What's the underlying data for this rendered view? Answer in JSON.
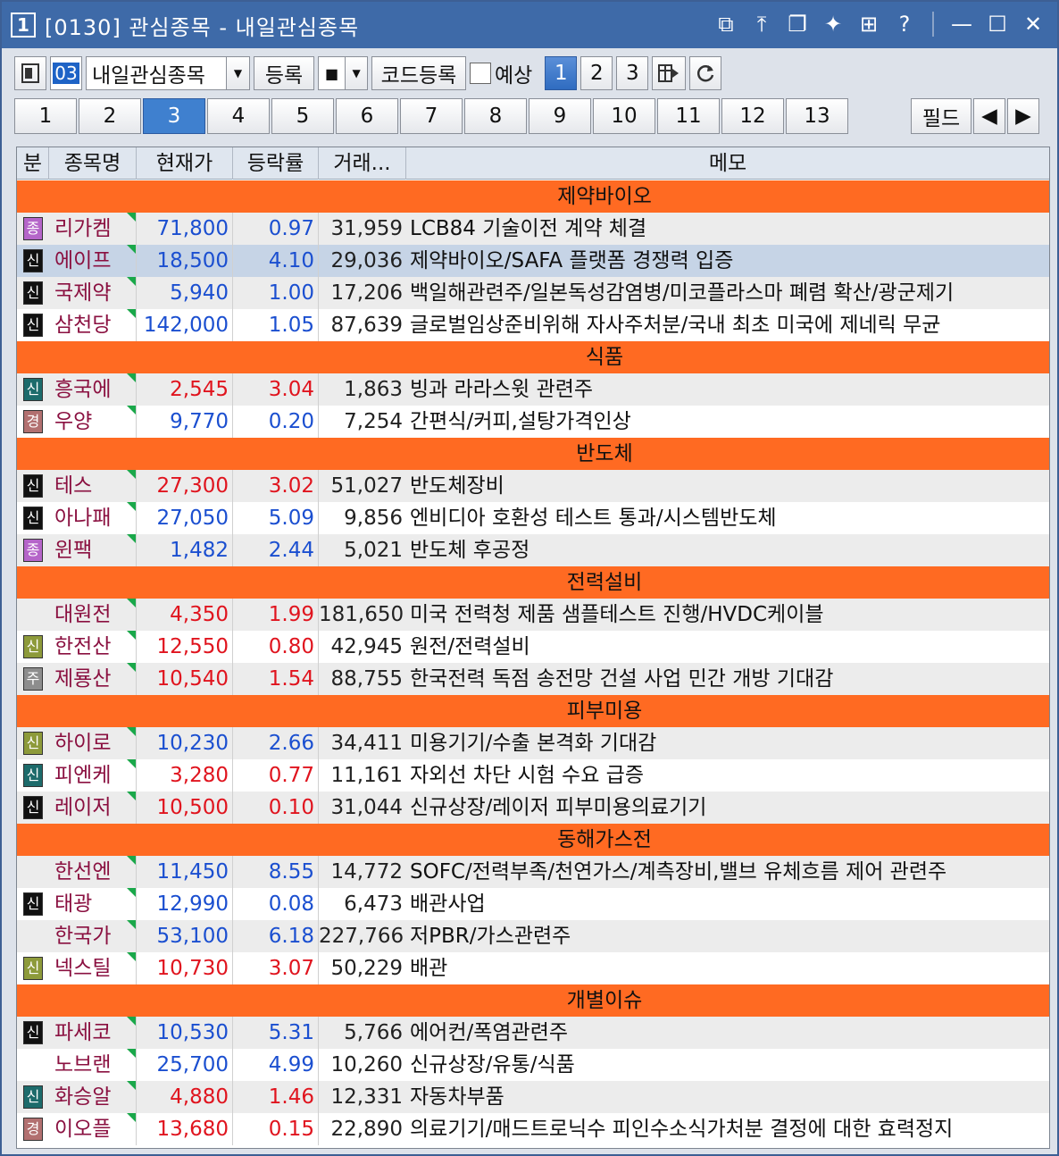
{
  "window": {
    "number": "1",
    "title": "[0130] 관심종목 - 내일관심종목"
  },
  "toolbar": {
    "group_code": "03",
    "group_name": "내일관심종목",
    "register_label": "등록",
    "code_register_label": "코드등록",
    "forecast_label": "예상",
    "pages": [
      "1",
      "2",
      "3"
    ],
    "active_page": "1"
  },
  "tabs": [
    "1",
    "2",
    "3",
    "4",
    "5",
    "6",
    "7",
    "8",
    "9",
    "10",
    "11",
    "12",
    "13"
  ],
  "active_tab": "3",
  "field_label": "필드",
  "columns": {
    "bun": "분",
    "name": "종목명",
    "price": "현재가",
    "rate": "등락률",
    "volume": "거래...",
    "memo": "메모"
  },
  "groups": [
    {
      "title": "제약바이오",
      "rows": [
        {
          "badge": "종",
          "name": "리가켐",
          "price": "71,800",
          "rate": "0.97",
          "volume": "31,959",
          "memo": "LCB84 기술이전 계약 체결",
          "dir": "dn"
        },
        {
          "badge": "신",
          "name": "에이프",
          "price": "18,500",
          "rate": "4.10",
          "volume": "29,036",
          "memo": "제약바이오/SAFA 플랫폼 경쟁력 입증",
          "dir": "dn",
          "selected": true
        },
        {
          "badge": "신",
          "name": "국제약",
          "price": "5,940",
          "rate": "1.00",
          "volume": "17,206",
          "memo": "백일해관련주/일본독성감염병/미코플라스마 폐렴 확산/광군제기",
          "dir": "dn"
        },
        {
          "badge": "신",
          "name": "삼천당",
          "price": "142,000",
          "rate": "1.05",
          "volume": "87,639",
          "memo": "글로벌임상준비위해 자사주처분/국내 최초 미국에 제네릭 무균",
          "dir": "dn"
        }
      ]
    },
    {
      "title": "식품",
      "rows": [
        {
          "badge": "신",
          "name": "흥국에",
          "price": "2,545",
          "rate": "3.04",
          "volume": "1,863",
          "memo": "빙과 라라스윗 관련주",
          "dir": "up"
        },
        {
          "badge": "경",
          "name": "우양",
          "price": "9,770",
          "rate": "0.20",
          "volume": "7,254",
          "memo": "간편식/커피,설탕가격인상",
          "dir": "dn"
        }
      ]
    },
    {
      "title": "반도체",
      "rows": [
        {
          "badge": "신",
          "name": "테스",
          "price": "27,300",
          "rate": "3.02",
          "volume": "51,027",
          "memo": "반도체장비",
          "dir": "up"
        },
        {
          "badge": "신",
          "name": "아나패",
          "price": "27,050",
          "rate": "5.09",
          "volume": "9,856",
          "memo": "엔비디아 호환성 테스트 통과/시스템반도체",
          "dir": "dn"
        },
        {
          "badge": "종",
          "name": "윈팩",
          "price": "1,482",
          "rate": "2.44",
          "volume": "5,021",
          "memo": "반도체 후공정",
          "dir": "dn"
        }
      ]
    },
    {
      "title": "전력설비",
      "rows": [
        {
          "badge": "",
          "name": "대원전",
          "price": "4,350",
          "rate": "1.99",
          "volume": "181,650",
          "memo": "미국 전력청 제품 샘플테스트 진행/HVDC케이블",
          "dir": "up"
        },
        {
          "badge": "신",
          "name": "한전산",
          "price": "12,550",
          "rate": "0.80",
          "volume": "42,945",
          "memo": "원전/전력설비",
          "dir": "up"
        },
        {
          "badge": "주",
          "name": "제룡산",
          "price": "10,540",
          "rate": "1.54",
          "volume": "88,755",
          "memo": "한국전력 독점 송전망 건설 사업 민간 개방 기대감",
          "dir": "up"
        }
      ]
    },
    {
      "title": "피부미용",
      "rows": [
        {
          "badge": "신",
          "name": "하이로",
          "price": "10,230",
          "rate": "2.66",
          "volume": "34,411",
          "memo": "미용기기/수출 본격화 기대감",
          "dir": "dn"
        },
        {
          "badge": "신",
          "name": "피엔케",
          "price": "3,280",
          "rate": "0.77",
          "volume": "11,161",
          "memo": "자외선 차단 시험 수요 급증",
          "dir": "up"
        },
        {
          "badge": "신",
          "name": "레이저",
          "price": "10,500",
          "rate": "0.10",
          "volume": "31,044",
          "memo": "신규상장/레이저 피부미용의료기기",
          "dir": "up"
        }
      ]
    },
    {
      "title": "동해가스전",
      "rows": [
        {
          "badge": "",
          "name": "한선엔",
          "price": "11,450",
          "rate": "8.55",
          "volume": "14,772",
          "memo": "SOFC/전력부족/천연가스/계측장비,밸브 유체흐름 제어 관련주",
          "dir": "dn"
        },
        {
          "badge": "신",
          "name": "태광",
          "price": "12,990",
          "rate": "0.08",
          "volume": "6,473",
          "memo": "배관사업",
          "dir": "dn"
        },
        {
          "badge": "",
          "name": "한국가",
          "price": "53,100",
          "rate": "6.18",
          "volume": "227,766",
          "memo": "저PBR/가스관련주",
          "dir": "dn"
        },
        {
          "badge": "신",
          "name": "넥스틸",
          "price": "10,730",
          "rate": "3.07",
          "volume": "50,229",
          "memo": "배관",
          "dir": "up"
        }
      ]
    },
    {
      "title": "개별이슈",
      "rows": [
        {
          "badge": "신",
          "name": "파세코",
          "price": "10,530",
          "rate": "5.31",
          "volume": "5,766",
          "memo": "에어컨/폭염관련주",
          "dir": "dn"
        },
        {
          "badge": "",
          "name": "노브랜",
          "price": "25,700",
          "rate": "4.99",
          "volume": "10,260",
          "memo": "신규상장/유통/식품",
          "dir": "dn"
        },
        {
          "badge": "신",
          "name": "화승알",
          "price": "4,880",
          "rate": "1.46",
          "volume": "12,331",
          "memo": "자동차부품",
          "dir": "up"
        },
        {
          "badge": "경",
          "name": "이오플",
          "price": "13,680",
          "rate": "0.15",
          "volume": "22,890",
          "memo": "의료기기/매드트로닉수 피인수소식가처분 결정에 대한 효력정지",
          "dir": "up"
        }
      ]
    }
  ],
  "colors": {
    "group_header": "#ff6a22",
    "up": "#e0141e",
    "down": "#1b4fd0",
    "title_bar": "#3e6aa8"
  }
}
